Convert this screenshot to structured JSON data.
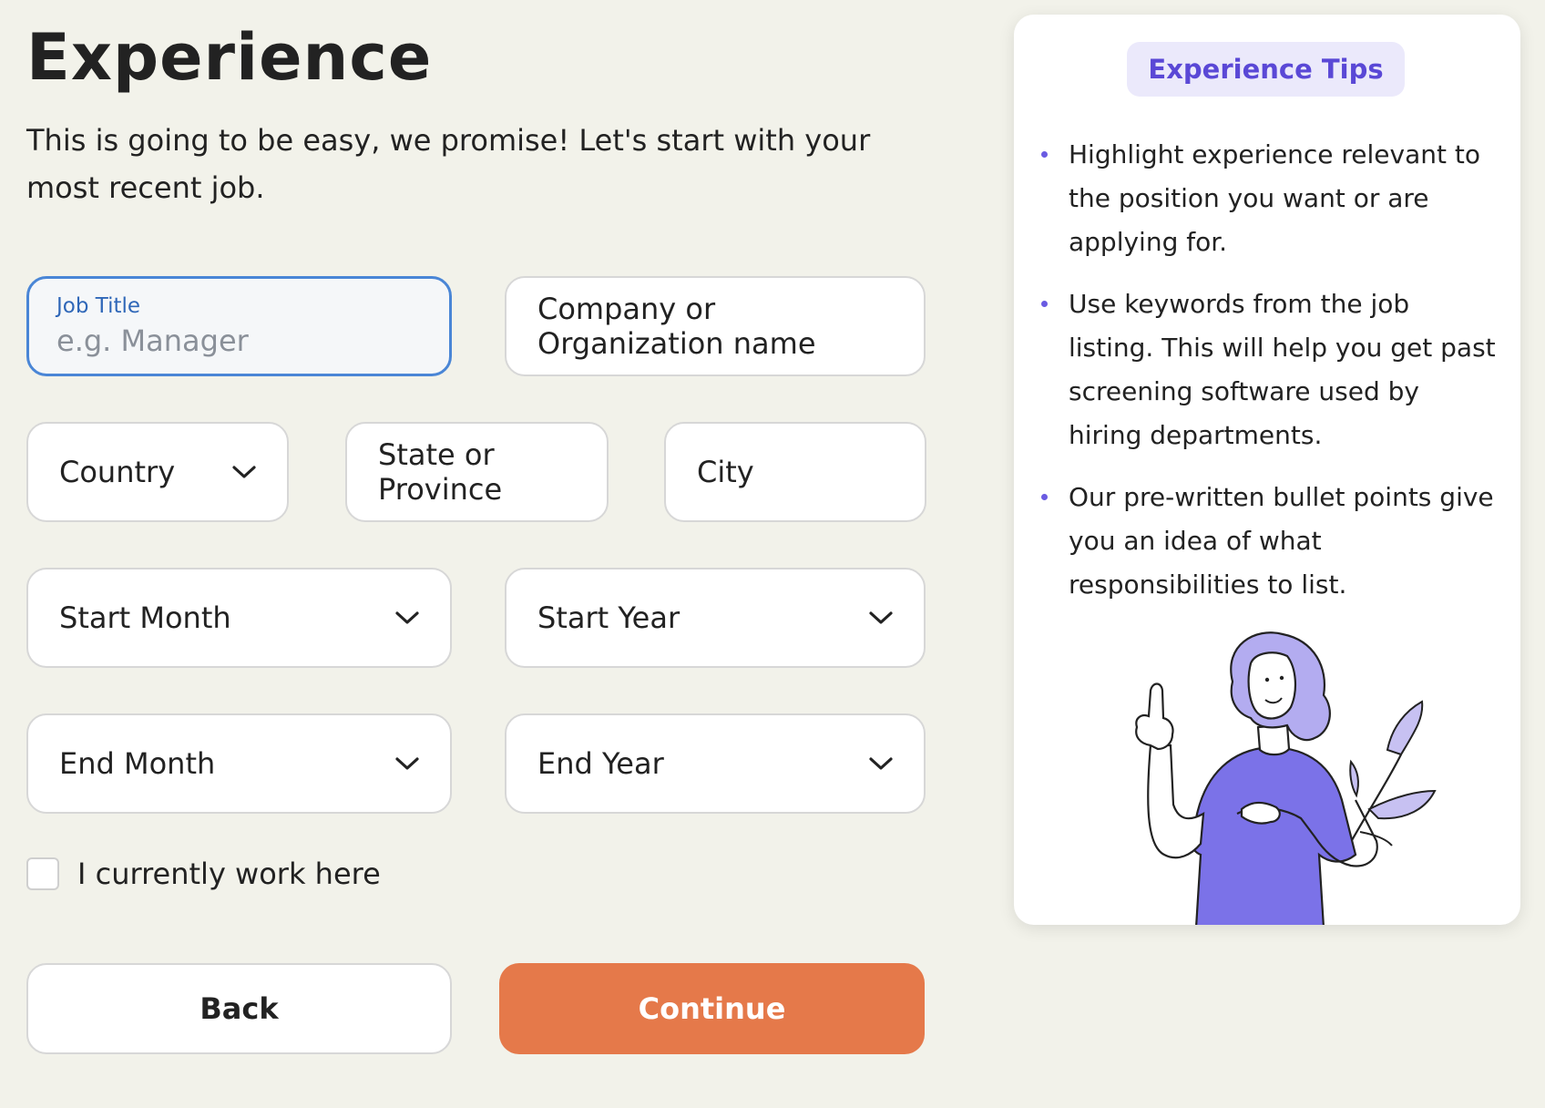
{
  "page": {
    "title": "Experience",
    "subtitle": "This is going to be easy, we promise! Let's start with your most recent job."
  },
  "form": {
    "job_title": {
      "label": "Job Title",
      "placeholder": "e.g. Manager",
      "value": ""
    },
    "company": {
      "line1": "Company or",
      "line2": "Organization name"
    },
    "country": {
      "label": "Country"
    },
    "state": {
      "line1": "State or",
      "line2": "Province"
    },
    "city": {
      "label": "City"
    },
    "start_month": {
      "label": "Start Month"
    },
    "start_year": {
      "label": "Start Year"
    },
    "end_month": {
      "label": "End Month"
    },
    "end_year": {
      "label": "End Year"
    },
    "currently_work_here": {
      "label": "I currently work here",
      "checked": false
    }
  },
  "buttons": {
    "back": "Back",
    "continue": "Continue"
  },
  "tips": {
    "badge": "Experience Tips",
    "items": [
      "Highlight experience relevant to the position you want or are applying for.",
      "Use keywords from the job listing. This will help you get past screening software used by hiring departments.",
      "Our pre-written bullet points give you an idea of what responsibilities to list."
    ]
  },
  "colors": {
    "background": "#f2f2ea",
    "accent": "#e5794a",
    "focus": "#4a86d6",
    "tips_accent": "#5a48d6",
    "illustration": "#7b72e8"
  },
  "icons": {
    "dropdown": "chevron-down-icon",
    "illustration": "woman-pointing-illustration"
  }
}
